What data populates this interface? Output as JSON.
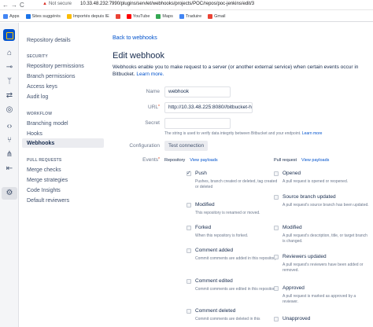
{
  "browser": {
    "not_secure": "Not secure",
    "url": "10.33.48.232:7990/plugins/servlet/webhooks/projects/POC/repos/poc-jenkins/edit/3",
    "bookmarks": [
      "Apps",
      "Sites suggérés",
      "Importés depuis IE",
      "YouTube",
      "Maps",
      "Traduire",
      "Gmail"
    ]
  },
  "sidebar": {
    "items_top": [
      "Repository details"
    ],
    "security_heading": "SECURITY",
    "security_items": [
      "Repository permissions",
      "Branch permissions",
      "Access keys",
      "Audit log"
    ],
    "workflow_heading": "WORKFLOW",
    "workflow_items": [
      "Branching model",
      "Hooks",
      "Webhooks"
    ],
    "pr_heading": "PULL REQUESTS",
    "pr_items": [
      "Merge checks",
      "Merge strategies",
      "Code Insights",
      "Default reviewers"
    ]
  },
  "main": {
    "back": "Back to webhooks",
    "title": "Edit webhook",
    "desc_plain": "Webhooks enable you to make request to a server (or another external service) when certain events occur in Bitbucket.",
    "desc_link": "Learn more.",
    "name_label": "Name",
    "name_value": "webhook",
    "url_label": "URL",
    "url_value": "http://10.33.48.225:8080//bitbucket-hc",
    "secret_label": "Secret",
    "secret_hint": "The string is used to verify data integrity between Bitbucket and your endpoint.",
    "secret_hint_link": "Learn more",
    "config_label": "Configuration",
    "test_button": "Test connection",
    "events_label": "Events",
    "repo_head": "Repository",
    "pr_head": "Pull request",
    "view_payloads": "View payloads",
    "repo_events": [
      {
        "name": "Push",
        "desc": "Pushes, branch created or deleted, tag created or deleted",
        "checked": true
      },
      {
        "name": "Modified",
        "desc": "This repository is renamed or moved.",
        "checked": false
      },
      {
        "name": "Forked",
        "desc": "When this repository is forked.",
        "checked": false
      },
      {
        "name": "Comment added",
        "desc": "Commit comments are added in this repository.",
        "checked": false
      },
      {
        "name": "Comment edited",
        "desc": "Commit comments are edited in this repository.",
        "checked": false
      },
      {
        "name": "Comment deleted",
        "desc": "Commit comments are deleted in this",
        "checked": false
      }
    ],
    "pr_events": [
      {
        "name": "Opened",
        "desc": "A pull request is opened or reopened.",
        "checked": false
      },
      {
        "name": "Source branch updated",
        "desc": "A pull request's source branch has been updated.",
        "checked": false
      },
      {
        "name": "Modified",
        "desc": "A pull request's description, title, or target branch is changed.",
        "checked": false
      },
      {
        "name": "Reviewers updated",
        "desc": "A pull request's reviewers have been added or removed.",
        "checked": false
      },
      {
        "name": "Approved",
        "desc": "A pull request is marked as approved by a reviewer.",
        "checked": false
      },
      {
        "name": "Unapproved",
        "desc": "",
        "checked": false
      }
    ]
  }
}
